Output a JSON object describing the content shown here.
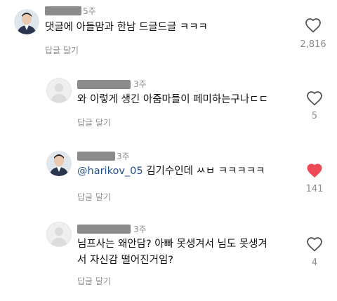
{
  "colors": {
    "text": "#111111",
    "muted": "#8e8e8e",
    "mention": "#264f8a",
    "liked_heart": "#ed4956",
    "redacted": "#8b8b8b"
  },
  "comments": [
    {
      "time": "5주",
      "text": "댓글에 아들맘과 한남 드글드글 ㅋㅋㅋ",
      "reply_label": "답글 달기",
      "likes": "2,816",
      "liked": false,
      "avatar": "profile-photo"
    },
    {
      "time": "3주",
      "text": "와 이렇게 생긴 아줌마들이 페미하는구나ㄷㄷ",
      "reply_label": "답글 달기",
      "likes": "5",
      "liked": false,
      "avatar": "default-placeholder"
    },
    {
      "time": "3주",
      "mention": "@harikov_05",
      "text": " 김기수인데 ㅆㅂ ㅋㅋㅋㅋㅋ",
      "reply_label": "답글 달기",
      "likes": "141",
      "liked": true,
      "avatar": "profile-photo"
    },
    {
      "time": "3주",
      "text_line1": "님프사는 왜안담? 아빠 못생겨서 님도 못생겨",
      "text_line2": "서 자신감 떨어진거임?",
      "reply_label": "답글 달기",
      "likes": "4",
      "liked": false,
      "avatar": "default-placeholder"
    }
  ]
}
